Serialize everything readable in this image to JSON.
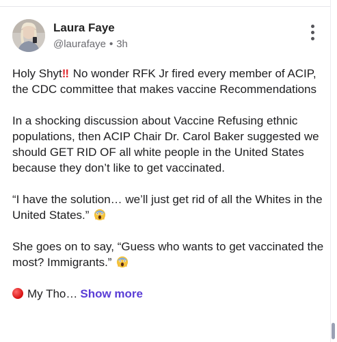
{
  "post": {
    "author_name": "Laura Faye",
    "handle": "@laurafaye",
    "separator": "•",
    "time_ago": "3h",
    "avatar_icon": "user-avatar-photo",
    "more_icon": "vertical-ellipsis-icon",
    "paragraphs": {
      "p1_prefix": "Holy Shyt",
      "p1_emoji": "‼",
      "p1_rest": " No wonder RFK Jr fired every member of ACIP, the CDC committee that makes vaccine Recommendations",
      "p2": "In a shocking discussion about Vaccine Refusing ethnic populations, then ACIP Chair Dr. Carol Baker suggested we should GET RID OF all white people in the United States because they don’t like to get vaccinated.",
      "p3": "“I have the solution… we’ll just get rid of all the Whites in the United States.”",
      "p4": "She goes on to say, “Guess who wants to get vaccinated the most? Immigrants.”",
      "p5_truncated": "My Tho…"
    },
    "show_more_label": "Show more",
    "colors": {
      "accent": "#5a3dd6",
      "emoji_red": "#e0282e"
    }
  }
}
